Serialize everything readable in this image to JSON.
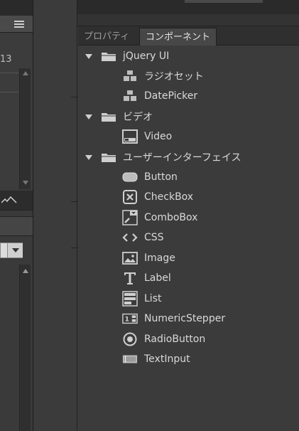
{
  "left_panel": {
    "ruler_number": "13"
  },
  "toolbar": {
    "collapse": "<<",
    "tools": [
      {
        "name": "palette-icon"
      },
      {
        "name": "table-grid-icon"
      },
      {
        "name": "align-left-icon"
      },
      {
        "name": "info-icon"
      },
      {
        "name": "transform-box-icon"
      },
      {
        "name": "creative-cloud-icon"
      }
    ]
  },
  "tabs": [
    {
      "label": "プロパティ",
      "active": false
    },
    {
      "label": "コンポーネント",
      "active": true
    }
  ],
  "tree": {
    "groups": [
      {
        "label": "jQuery UI",
        "items": [
          {
            "label": "ラジオセット",
            "icon": "widget-block-icon"
          },
          {
            "label": "DatePicker",
            "icon": "widget-block-icon"
          }
        ]
      },
      {
        "label": "ビデオ",
        "items": [
          {
            "label": "Video",
            "icon": "video-icon"
          }
        ]
      },
      {
        "label": "ユーザーインターフェイス",
        "items": [
          {
            "label": "Button",
            "icon": "button-icon"
          },
          {
            "label": "CheckBox",
            "icon": "checkbox-icon"
          },
          {
            "label": "ComboBox",
            "icon": "combobox-icon"
          },
          {
            "label": "CSS",
            "icon": "css-icon"
          },
          {
            "label": "Image",
            "icon": "image-icon"
          },
          {
            "label": "Label",
            "icon": "label-icon"
          },
          {
            "label": "List",
            "icon": "list-icon"
          },
          {
            "label": "NumericStepper",
            "icon": "numeric-stepper-icon"
          },
          {
            "label": "RadioButton",
            "icon": "radio-button-icon"
          },
          {
            "label": "TextInput",
            "icon": "text-input-icon"
          }
        ]
      }
    ]
  }
}
